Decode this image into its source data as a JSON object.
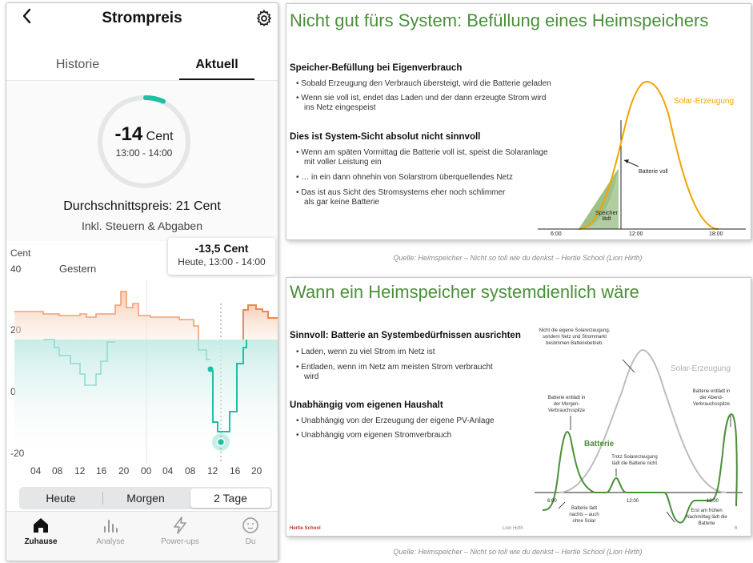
{
  "app": {
    "title": "Strompreis",
    "tabs": [
      "Historie",
      "Aktuell"
    ],
    "current_price": "-14",
    "current_unit": "Cent",
    "current_time": "13:00 - 14:00",
    "avg_price": "Durchschnittspreis: 21 Cent",
    "avg_note": "Inkl. Steuern & Abgaben",
    "chart_unit": "Cent",
    "yesterday_label": "Gestern",
    "tooltip_value": "-13,5 Cent",
    "tooltip_time": "Heute, 13:00 - 14:00",
    "y_ticks": [
      "40",
      "20",
      "0",
      "-20"
    ],
    "x_ticks": [
      "04",
      "08",
      "12",
      "16",
      "20",
      "00",
      "04",
      "08",
      "12",
      "16",
      "20"
    ],
    "range_buttons": [
      "Heute",
      "Morgen",
      "2 Tage"
    ],
    "selected_range": "2 Tage",
    "nav": [
      {
        "label": "Zuhause",
        "icon": "home-icon",
        "active": true
      },
      {
        "label": "Analyse",
        "icon": "bar-chart-icon",
        "active": false
      },
      {
        "label": "Power-ups",
        "icon": "lightning-icon",
        "active": false
      },
      {
        "label": "Du",
        "icon": "face-icon",
        "active": false
      }
    ],
    "colors": {
      "accent": "#1fbfa5",
      "orange": "#f0a070",
      "teal": "#2fbfa8"
    }
  },
  "slide1": {
    "title": "Nicht gut fürs System: Befüllung eines Heimspeichers",
    "h1": "Speicher-Befüllung bei Eigenverbrauch",
    "b1": "Sobald Erzeugung den Verbrauch übersteigt, wird die Batterie geladen",
    "b2a": "Wenn sie voll ist, endet das Laden und der dann erzeugte Strom wird",
    "b2b": "ins Netz eingespeist",
    "h2": "Dies ist System-Sicht absolut nicht sinnvoll",
    "b3a": "Wenn am späten Vormittag die Batterie voll ist, speist die Solaranlage",
    "b3b": "mit voller Leistung ein",
    "b4": "… in ein dann ohnehin von Solarstrom überquellendes Netz",
    "b5a": "Das ist aus Sicht des Stromsystems eher noch schlimmer",
    "b5b": "als gar keine Batterie",
    "curve_label": "Solar-Erzeugung",
    "ann_full": "Batterie voll",
    "ann_charge_a": "Speicher",
    "ann_charge_b": "lädt",
    "x_ticks": [
      "6:00",
      "12:00",
      "18:00"
    ],
    "caption": "Quelle: Heimspeicher – Nicht so toll wie du denkst – Hertie School (Lion Hirth)"
  },
  "slide2": {
    "title": "Wann ein Heimspeicher systemdienlich wäre",
    "h1": "Sinnvoll: Batterie an Systembedürfnissen ausrichten",
    "b1": "Laden, wenn zu viel Strom im Netz ist",
    "b2a": "Entladen, wenn im Netz am meisten Strom verbraucht",
    "b2b": "wird",
    "h2": "Unabhängig vom eigenen Haushalt",
    "b3": "Unabhängig von der Erzeugung der eigene PV-Anlage",
    "b4": "Unabhängig vom eigenen Stromverbrauch",
    "note_top_a": "Nicht die eigene Solarerzeugung,",
    "note_top_b": "sondern Netz und Strommarkt",
    "note_top_c": "bestimmen Batteriebetrieb.",
    "curve_label": "Solar-Erzeugung",
    "battery_label": "Batterie",
    "ann_morning_a": "Batterie entlädt in",
    "ann_morning_b": "der Morgen-",
    "ann_morning_c": "Verbrauchsspitze",
    "ann_evening_a": "Batterie entlädt in",
    "ann_evening_b": "der Abend-",
    "ann_evening_c": "Verbrauchsspitze",
    "ann_noon_a": "Trotz Solarerzeugung",
    "ann_noon_b": "lädt die Batterie nicht",
    "ann_night_a": "Batterie lädt",
    "ann_night_b": "nachts – auch",
    "ann_night_c": "ohne Solar",
    "ann_afternoon_a": "Erst am frühen",
    "ann_afternoon_b": "Nachmittag lädt die",
    "ann_afternoon_c": "Batterie",
    "x_ticks": [
      "6:00",
      "12:00",
      "18:00"
    ],
    "logo": "Hertie School",
    "footer": "Lion Hirth",
    "page": "6",
    "caption": "Quelle: Heimspeicher – Nicht so toll wie du denkst – Hertie School (Lion Hirth)"
  }
}
